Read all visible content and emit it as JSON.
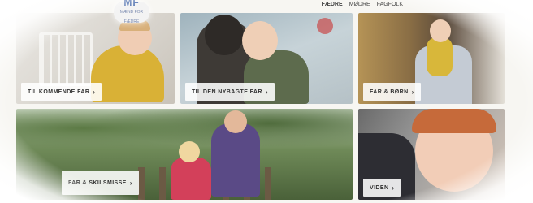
{
  "header": {
    "logo_text": "MF",
    "logo_sub": "MÆND FOR FÆDRE",
    "nav": [
      {
        "label": "FÆDRE",
        "active": true
      },
      {
        "label": "MØDRE",
        "active": false
      },
      {
        "label": "FAGFOLK",
        "active": false
      }
    ]
  },
  "cards": [
    {
      "id": "kommende",
      "button_label": "TIL KOMMENDE FAR",
      "chevron": "›"
    },
    {
      "id": "nybagte",
      "button_label": "TIL DEN NYBAGTE FAR",
      "chevron": "›"
    },
    {
      "id": "born",
      "button_label": "FAR & BØRN",
      "chevron": "›"
    },
    {
      "id": "skilsmisse",
      "button_label": "FAR & SKILSMISSE",
      "chevron": "›"
    },
    {
      "id": "viden",
      "button_label": "VIDEN",
      "chevron": "›"
    }
  ],
  "colors": {
    "background": "#f7f6f2",
    "button_bg": "#ffffff",
    "button_text": "#333333"
  }
}
